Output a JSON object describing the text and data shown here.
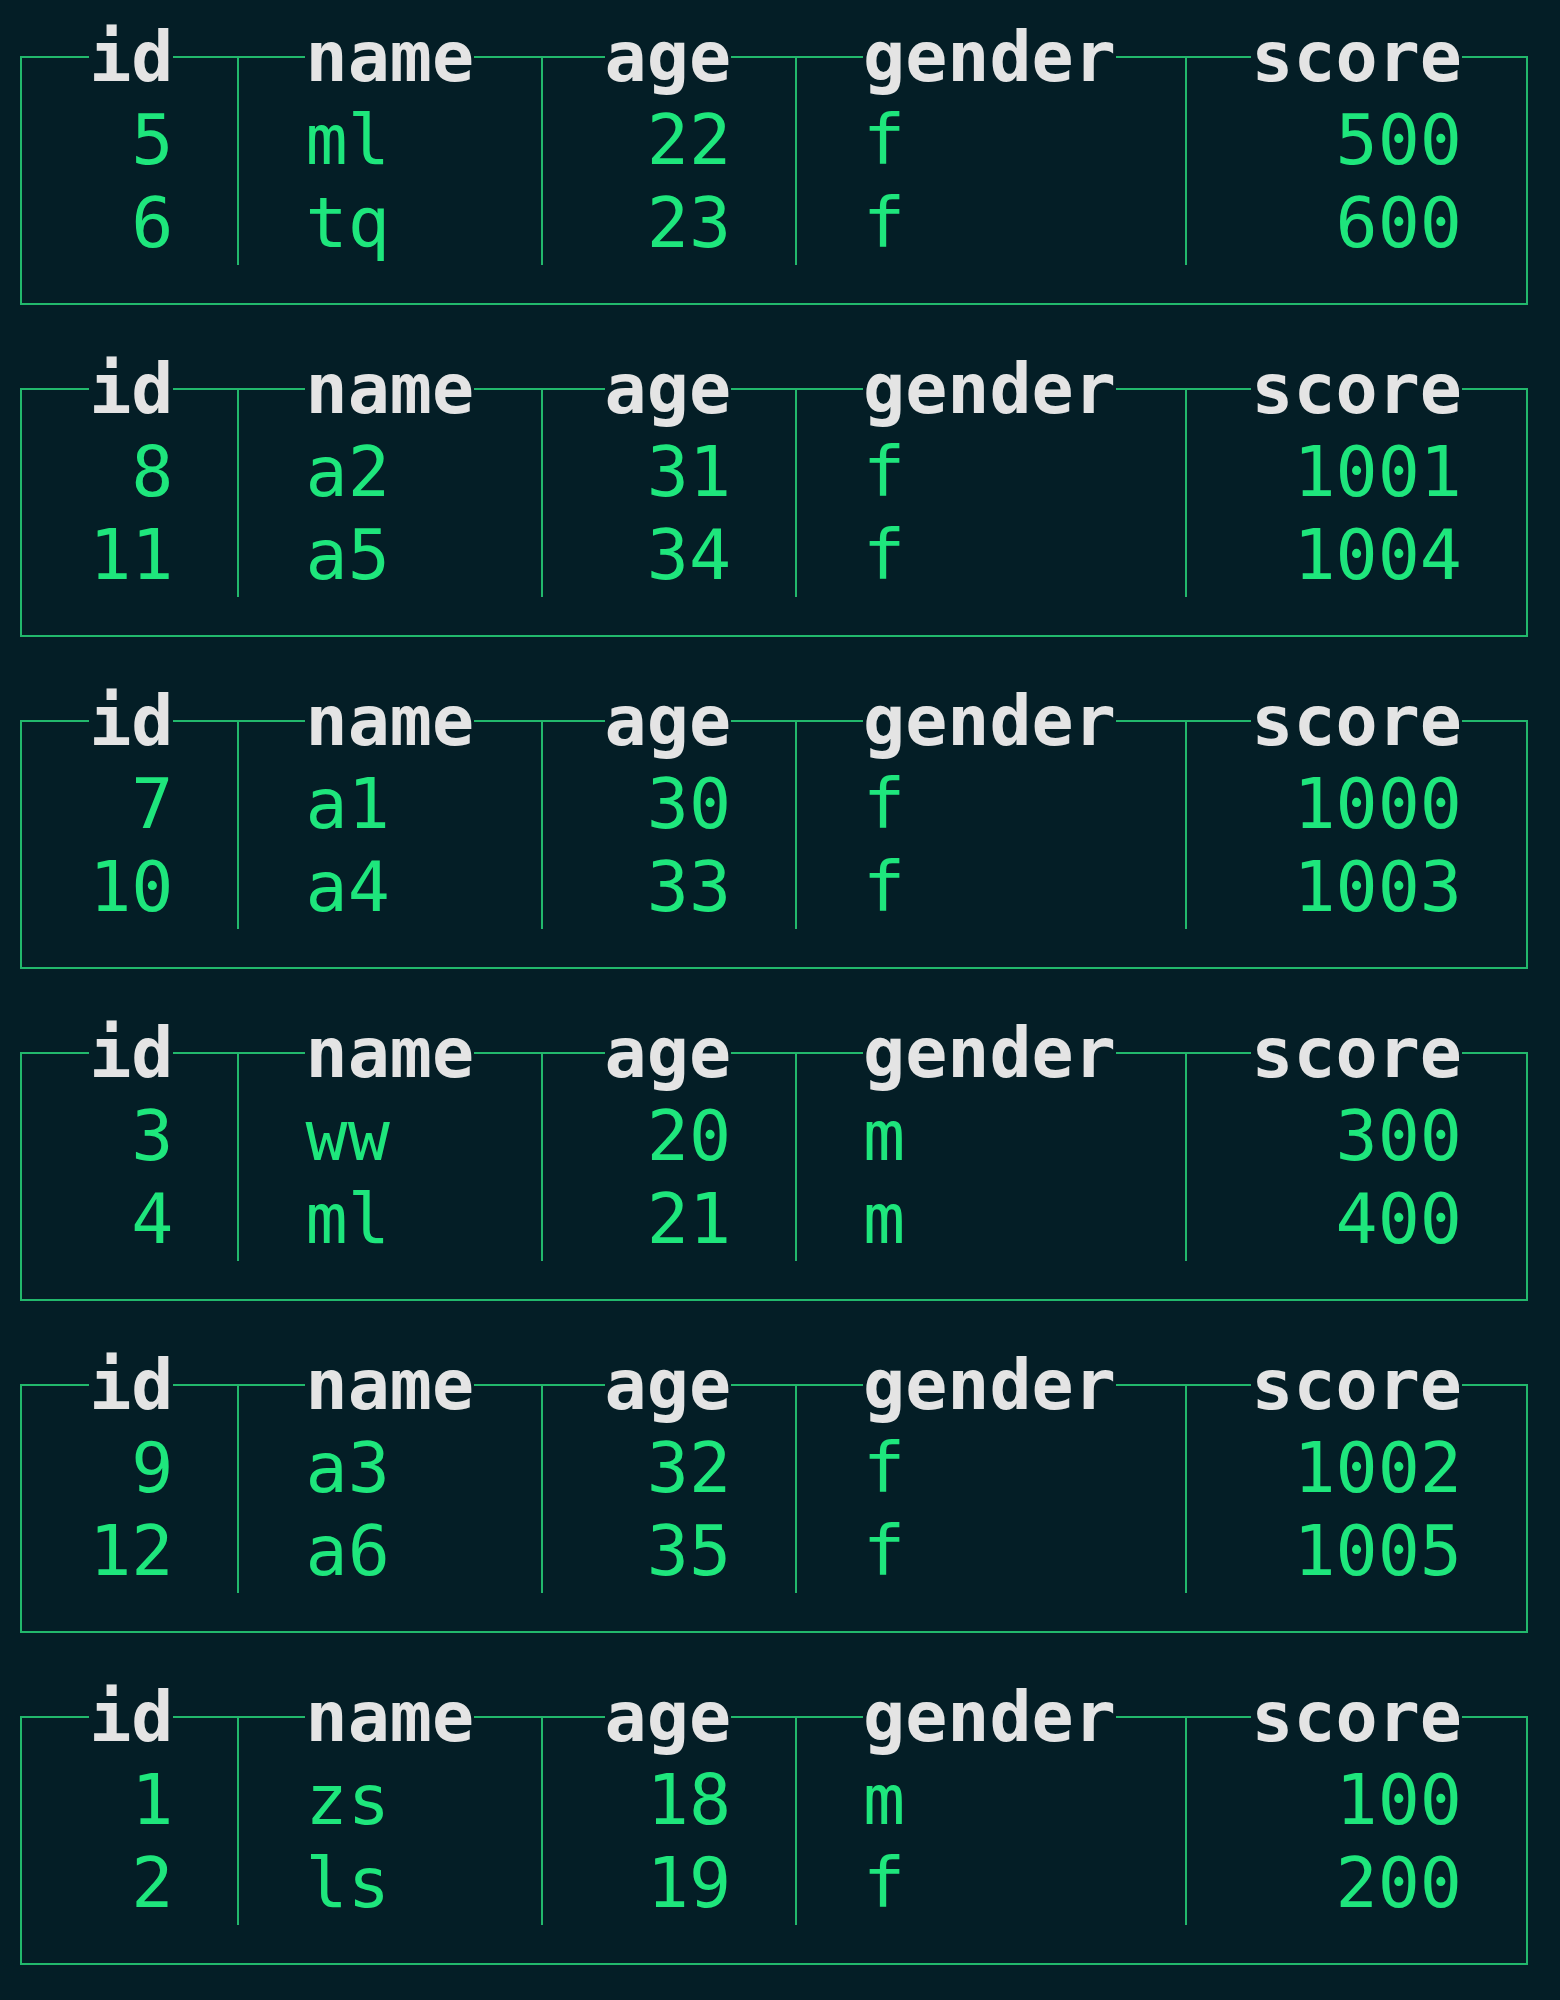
{
  "tables": [
    {
      "columns": [
        "id",
        "name",
        "age",
        "gender",
        "score"
      ],
      "rows": [
        [
          "5",
          "ml",
          "22",
          "f",
          "500"
        ],
        [
          "6",
          "tq",
          "23",
          "f",
          "600"
        ]
      ]
    },
    {
      "columns": [
        "id",
        "name",
        "age",
        "gender",
        "score"
      ],
      "rows": [
        [
          "8",
          "a2",
          "31",
          "f",
          "1001"
        ],
        [
          "11",
          "a5",
          "34",
          "f",
          "1004"
        ]
      ]
    },
    {
      "columns": [
        "id",
        "name",
        "age",
        "gender",
        "score"
      ],
      "rows": [
        [
          "7",
          "a1",
          "30",
          "f",
          "1000"
        ],
        [
          "10",
          "a4",
          "33",
          "f",
          "1003"
        ]
      ]
    },
    {
      "columns": [
        "id",
        "name",
        "age",
        "gender",
        "score"
      ],
      "rows": [
        [
          "3",
          "ww",
          "20",
          "m",
          "300"
        ],
        [
          "4",
          "ml",
          "21",
          "m",
          "400"
        ]
      ]
    },
    {
      "columns": [
        "id",
        "name",
        "age",
        "gender",
        "score"
      ],
      "rows": [
        [
          "9",
          "a3",
          "32",
          "f",
          "1002"
        ],
        [
          "12",
          "a6",
          "35",
          "f",
          "1005"
        ]
      ]
    },
    {
      "columns": [
        "id",
        "name",
        "age",
        "gender",
        "score"
      ],
      "rows": [
        [
          "1",
          "zs",
          "18",
          "m",
          "100"
        ],
        [
          "2",
          "ls",
          "19",
          "f",
          "200"
        ]
      ]
    }
  ]
}
